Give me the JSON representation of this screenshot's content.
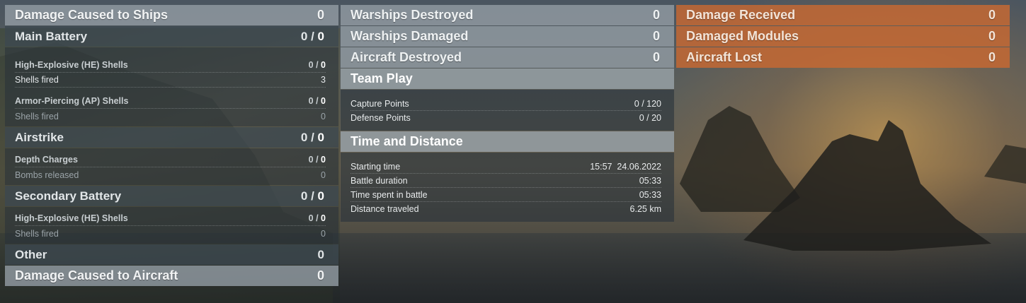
{
  "column1": {
    "damage_ships": {
      "label": "Damage Caused to Ships",
      "value": "0"
    },
    "main_battery": {
      "label": "Main Battery",
      "value_a": "0 / ",
      "value_b": "0",
      "he": {
        "label": "High-Explosive (HE) Shells",
        "value_a": "0 / ",
        "value_b": "0"
      },
      "he_fired": {
        "label": "Shells fired",
        "value": "3"
      },
      "ap": {
        "label": "Armor-Piercing (AP) Shells",
        "value_a": "0 / ",
        "value_b": "0"
      },
      "ap_fired": {
        "label": "Shells fired",
        "value": "0"
      }
    },
    "airstrike": {
      "label": "Airstrike",
      "value_a": "0 / ",
      "value_b": "0",
      "depth": {
        "label": "Depth Charges",
        "value_a": "0 / ",
        "value_b": "0"
      },
      "bombs": {
        "label": "Bombs released",
        "value": "0"
      }
    },
    "secondary": {
      "label": "Secondary Battery",
      "value_a": "0 / ",
      "value_b": "0",
      "he": {
        "label": "High-Explosive (HE) Shells",
        "value_a": "0 / ",
        "value_b": "0"
      },
      "he_fired": {
        "label": "Shells fired",
        "value": "0"
      }
    },
    "other": {
      "label": "Other",
      "value": "0"
    },
    "damage_aircraft": {
      "label": "Damage Caused to Aircraft",
      "value": "0"
    }
  },
  "column2": {
    "warships_destroyed": {
      "label": "Warships Destroyed",
      "value": "0"
    },
    "warships_damaged": {
      "label": "Warships Damaged",
      "value": "0"
    },
    "aircraft_destroyed": {
      "label": "Aircraft Destroyed",
      "value": "0"
    },
    "team_play": {
      "title": "Team Play",
      "capture": {
        "label": "Capture Points",
        "value": "0 / 120"
      },
      "defense": {
        "label": "Defense Points",
        "value": "0 / 20"
      }
    },
    "time_distance": {
      "title": "Time and Distance",
      "start": {
        "label": "Starting time",
        "value": "15:57  24.06.2022"
      },
      "duration": {
        "label": "Battle duration",
        "value": "05:33"
      },
      "spent": {
        "label": "Time spent in battle",
        "value": "05:33"
      },
      "distance": {
        "label": "Distance traveled",
        "value": "6.25 km"
      }
    }
  },
  "column3": {
    "damage_received": {
      "label": "Damage Received",
      "value": "0"
    },
    "damaged_modules": {
      "label": "Damaged Modules",
      "value": "0"
    },
    "aircraft_lost": {
      "label": "Aircraft Lost",
      "value": "0"
    }
  },
  "colors": {
    "accent_orange": "#c8693a",
    "panel_grey": "#919ba2",
    "panel_dark": "#3c4850"
  }
}
